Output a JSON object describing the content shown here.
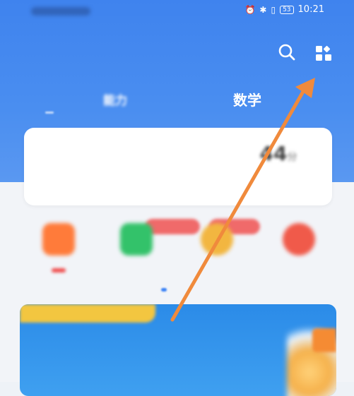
{
  "status_bar": {
    "time": "10:21",
    "battery": "53",
    "icons": [
      "alarm-icon",
      "bluetooth-icon",
      "vibrate-icon",
      "battery-icon"
    ]
  },
  "header": {
    "subtitle": "",
    "tabs": [
      {
        "label": "",
        "active": false
      },
      {
        "label_prefix": "",
        "label_strong": "能力",
        "active": false
      },
      {
        "label": "数学",
        "active": true
      }
    ]
  },
  "stats": [
    {
      "value": "",
      "unit": "",
      "label": ""
    },
    {
      "value": "",
      "unit": "",
      "label": ""
    },
    {
      "value": "44",
      "unit": "分",
      "label": ""
    }
  ],
  "features": [
    {
      "icon": "gift-icon",
      "label": "",
      "badge": true
    },
    {
      "icon": "calendar-icon",
      "label": "",
      "badge": false
    },
    {
      "icon": "medal-icon",
      "label": "",
      "badge": false
    },
    {
      "icon": "target-icon",
      "label": "",
      "badge": false
    }
  ],
  "banner": {
    "tag": "",
    "title_highlight": "",
    "title_rest": ""
  },
  "colors": {
    "header_blue": "#3f83ee",
    "annotation_arrow": "#f08a3c",
    "badge_red": "#f04c4c",
    "banner_yellow": "#f3c640"
  }
}
